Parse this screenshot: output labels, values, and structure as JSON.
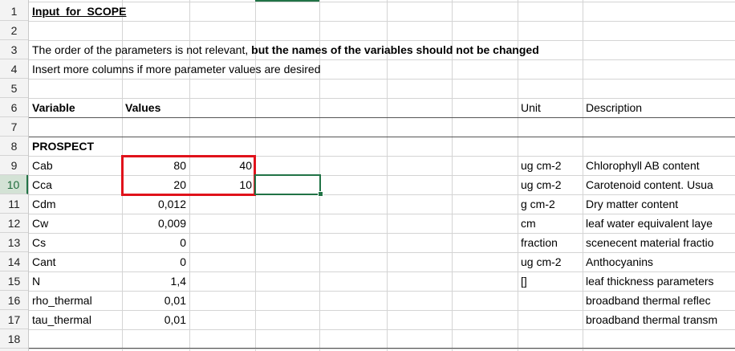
{
  "rows": [
    "1",
    "2",
    "3",
    "4",
    "5",
    "6",
    "7",
    "8",
    "9",
    "10",
    "11",
    "12",
    "13",
    "14",
    "15",
    "16",
    "17",
    "18"
  ],
  "a1": "Input_for_SCOPE",
  "a3_plain": "The order of the parameters is not relevant, ",
  "a3_bold": "but the names of the variables should not be changed",
  "a4": "Insert more columns if more parameter values are desired",
  "header": {
    "variable": "Variable",
    "values": "Values",
    "unit": "Unit",
    "description": "Description"
  },
  "section": "PROSPECT",
  "params": [
    {
      "name": "Cab",
      "v1": "80",
      "v2": "40",
      "unit": "ug cm-2",
      "desc": "Chlorophyll AB content"
    },
    {
      "name": "Cca",
      "v1": "20",
      "v2": "10",
      "unit": "ug cm-2",
      "desc": "Carotenoid content. Usua"
    },
    {
      "name": "Cdm",
      "v1": "0,012",
      "v2": "",
      "unit": "g cm-2",
      "desc": "Dry matter content"
    },
    {
      "name": "Cw",
      "v1": "0,009",
      "v2": "",
      "unit": "cm",
      "desc": "leaf water equivalent laye"
    },
    {
      "name": "Cs",
      "v1": "0",
      "v2": "",
      "unit": "fraction",
      "desc": "scenecent material fractio"
    },
    {
      "name": "Cant",
      "v1": "0",
      "v2": "",
      "unit": "ug cm-2",
      "desc": "Anthocyanins"
    },
    {
      "name": "N",
      "v1": "1,4",
      "v2": "",
      "unit": "[]",
      "desc": "leaf thickness parameters"
    },
    {
      "name": "rho_thermal",
      "v1": "0,01",
      "v2": "",
      "unit": "",
      "desc": "broadband thermal reflec"
    },
    {
      "name": "tau_thermal",
      "v1": "0,01",
      "v2": "",
      "unit": "",
      "desc": "broadband thermal transm"
    }
  ],
  "colors": {
    "highlight_box": "#e0121b",
    "selection": "#217346",
    "active_row_header": "#d3e2d5"
  }
}
